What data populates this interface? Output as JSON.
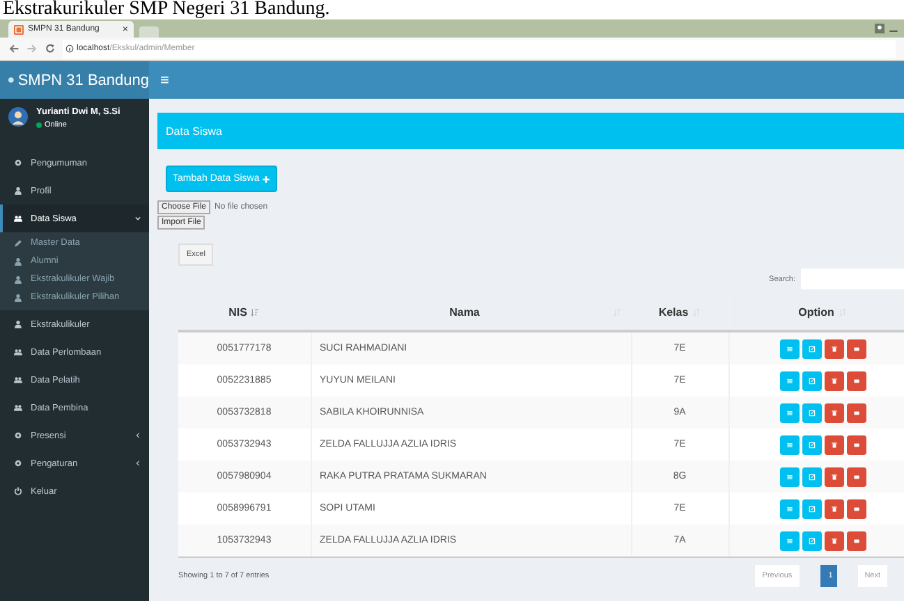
{
  "caption": "Ekstrakurikuler SMP Negeri 31 Bandung.",
  "browser": {
    "tab_title": "SMPN 31 Bandung",
    "tab_close": "×",
    "url_host": "localhost",
    "url_path": "/Ekskul/admin/Member"
  },
  "header": {
    "brand": "SMPN 31 Bandung",
    "menu_toggle": "≡"
  },
  "user": {
    "name": "Yurianti Dwi M, S.Si",
    "status": "Online"
  },
  "sidebar": {
    "items": [
      {
        "label": "Pengumuman",
        "kind": "settings",
        "selected": false
      },
      {
        "label": "Profil",
        "kind": "person",
        "selected": false
      },
      {
        "label": "Data Siswa",
        "kind": "group",
        "selected": true,
        "expanded": true,
        "children": [
          {
            "label": "Master Data",
            "kind": "edit",
            "selected": false
          },
          {
            "label": "Alumni",
            "kind": "person",
            "selected": false
          },
          {
            "label": "Ekstrakulikuler Wajib",
            "kind": "person",
            "selected": false
          },
          {
            "label": "Ekstrakulikuler Pilihan",
            "kind": "person",
            "selected": false
          }
        ]
      },
      {
        "label": "Ekstrakulikuler",
        "kind": "person",
        "selected": false
      },
      {
        "label": "Data Perlombaan",
        "kind": "group",
        "selected": false
      },
      {
        "label": "Data Pelatih",
        "kind": "group",
        "selected": false
      },
      {
        "label": "Data Pembina",
        "kind": "group",
        "selected": false
      },
      {
        "label": "Presensi",
        "kind": "settings",
        "selected": false,
        "expanded": false
      },
      {
        "label": "Pengaturan",
        "kind": "settings",
        "selected": false,
        "expanded": false
      },
      {
        "label": "Keluar",
        "kind": "logout",
        "selected": false
      }
    ]
  },
  "box": {
    "title": "Data Siswa",
    "add_button": "Tambah Data Siswa",
    "choose_file": "Choose File",
    "file_status": "No file chosen",
    "import_button": "Import File",
    "excel_button": "Excel",
    "search_label": "Search:"
  },
  "table": {
    "columns": [
      {
        "label": "NIS",
        "sorted": true
      },
      {
        "label": "Nama",
        "sorted": false
      },
      {
        "label": "Kelas",
        "sorted": false
      },
      {
        "label": "Option",
        "sorted": false
      }
    ],
    "option_actions": [
      {
        "kind": "list",
        "color": "#00c0ef"
      },
      {
        "kind": "edit",
        "color": "#00c0ef"
      },
      {
        "kind": "delete",
        "color": "#dd4b39"
      },
      {
        "kind": "card",
        "color": "#dd4b39"
      }
    ],
    "rows": [
      {
        "nis": "0051777178",
        "nama": "SUCI RAHMADIANI",
        "kelas": "7E"
      },
      {
        "nis": "0052231885",
        "nama": "YUYUN MEILANI",
        "kelas": "7E"
      },
      {
        "nis": "0053732818",
        "nama": "SABILA KHOIRUNNISA",
        "kelas": "9A"
      },
      {
        "nis": "0053732943",
        "nama": "ZELDA FALLUJJA AZLIA IDRIS",
        "kelas": "7E"
      },
      {
        "nis": "0057980904",
        "nama": "RAKA PUTRA PRATAMA SUKMARAN",
        "kelas": "8G"
      },
      {
        "nis": "0058996791",
        "nama": "SOPI UTAMI",
        "kelas": "7E"
      },
      {
        "nis": "1053732943",
        "nama": "ZELDA FALLUJJA AZLIA IDRIS",
        "kelas": "7A"
      }
    ]
  },
  "footer": {
    "info": "Showing 1 to 7 of 7 entries",
    "previous": "Previous",
    "pages": [
      {
        "label": "1",
        "selected": true
      }
    ],
    "next": "Next"
  }
}
